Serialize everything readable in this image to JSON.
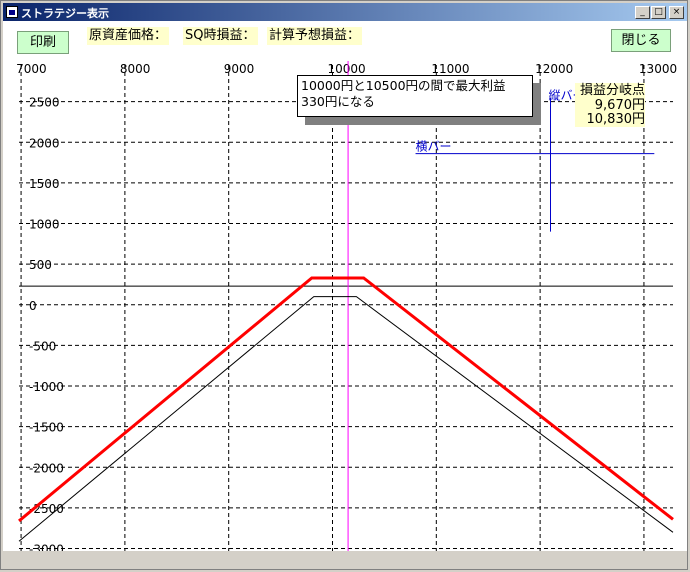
{
  "window": {
    "title": "ストラテジー表示"
  },
  "titlebar_buttons": {
    "minimize": "_",
    "maximize": "□",
    "close": "×"
  },
  "toolbar": {
    "print_label": "印刷",
    "close_label": "閉じる",
    "underlying_price_label": "原資産価格：",
    "sq_pnl_label": "SQ時損益：",
    "estimated_pnl_label": "計算予想損益："
  },
  "annotations": {
    "callout_line1": "10000円と10500円の間で最大利益",
    "callout_line2": "330円になる",
    "vertical_bar_label": "縦バー",
    "horizontal_bar_label": "横バー",
    "breakeven_title": "損益分岐点",
    "breakeven_values": [
      "9,670円",
      "10,830円"
    ]
  },
  "colors": {
    "payoff_sq": "#ff0000",
    "payoff_estimate": "#000000",
    "cursor_line": "#ff00ff",
    "bars": "#0000cc",
    "button_bg": "#ccffcc",
    "label_bg": "#ffffcc"
  },
  "chart_data": {
    "type": "line",
    "x_ticks": [
      7000,
      8000,
      9000,
      10000,
      11000,
      12000,
      13000
    ],
    "y_ticks": [
      2500,
      2000,
      1500,
      1000,
      500,
      0,
      -500,
      -1000,
      -1500,
      -2000,
      -2500,
      -3000
    ],
    "xlim": [
      6980,
      13280
    ],
    "ylim": [
      -3030,
      3000
    ],
    "grid": true,
    "series": [
      {
        "color": "#ff0000",
        "points": [
          [
            6980,
            -2660
          ],
          [
            9800,
            330
          ],
          [
            10300,
            330
          ],
          [
            13280,
            -2640
          ]
        ]
      },
      {
        "color": "#000000",
        "points": [
          [
            6980,
            -2910
          ],
          [
            9820,
            100
          ],
          [
            10230,
            100
          ],
          [
            13280,
            -2800
          ]
        ]
      }
    ],
    "zero_line": 230,
    "cursor_x": 10150,
    "vertical_bar_x": 12100,
    "vertical_bar_y_range": [
      900,
      2550
    ],
    "horizontal_bar_y": 1860,
    "horizontal_bar_x_range": [
      10800,
      13100
    ]
  }
}
